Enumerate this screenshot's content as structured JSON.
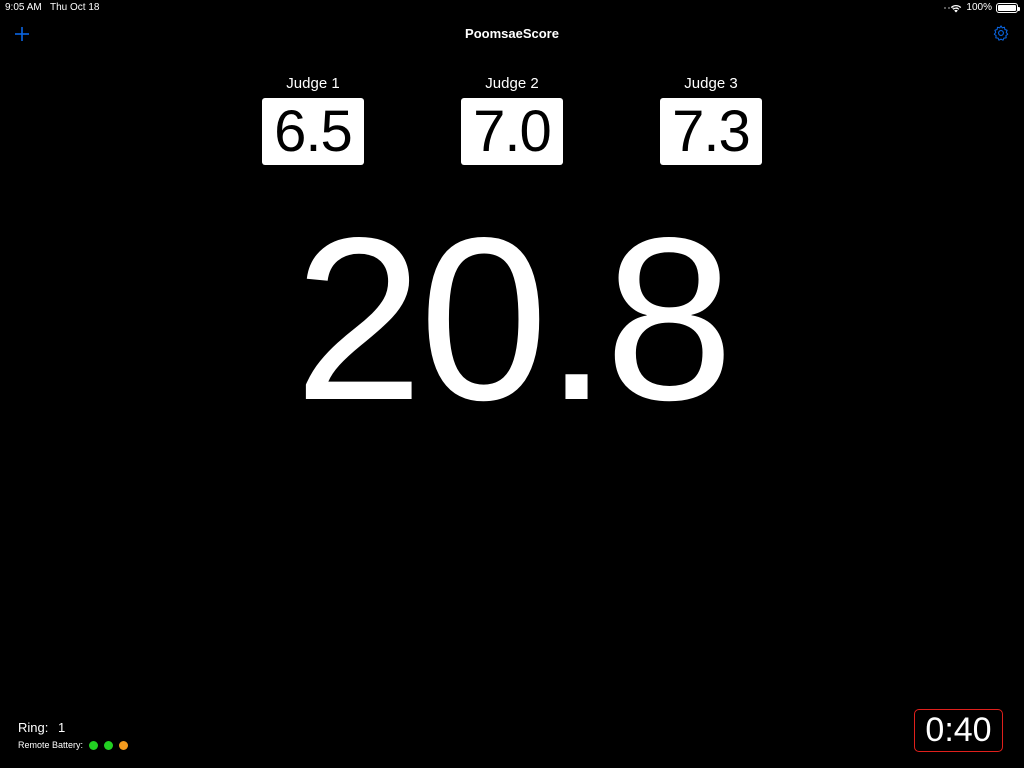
{
  "status_bar": {
    "time": "9:05 AM",
    "date": "Thu Oct 18",
    "battery_percent": "100%",
    "battery_level": 1.0,
    "icons": [
      "wifi-icon",
      "battery-icon"
    ]
  },
  "nav": {
    "title": "PoomsaeScore",
    "add_icon": "plus-icon",
    "settings_icon": "gear-icon",
    "accent_color": "#0a66e4"
  },
  "judges": [
    {
      "label": "Judge 1",
      "score": "6.5"
    },
    {
      "label": "Judge 2",
      "score": "7.0"
    },
    {
      "label": "Judge 3",
      "score": "7.3"
    }
  ],
  "total_score": "20.8",
  "ring": {
    "label": "Ring:",
    "value": "1"
  },
  "remote_battery": {
    "label": "Remote Battery:",
    "indicators": [
      "#22d022",
      "#22d022",
      "#f29a1e"
    ]
  },
  "timer": {
    "value": "0:40",
    "border_color": "#e0201c"
  }
}
